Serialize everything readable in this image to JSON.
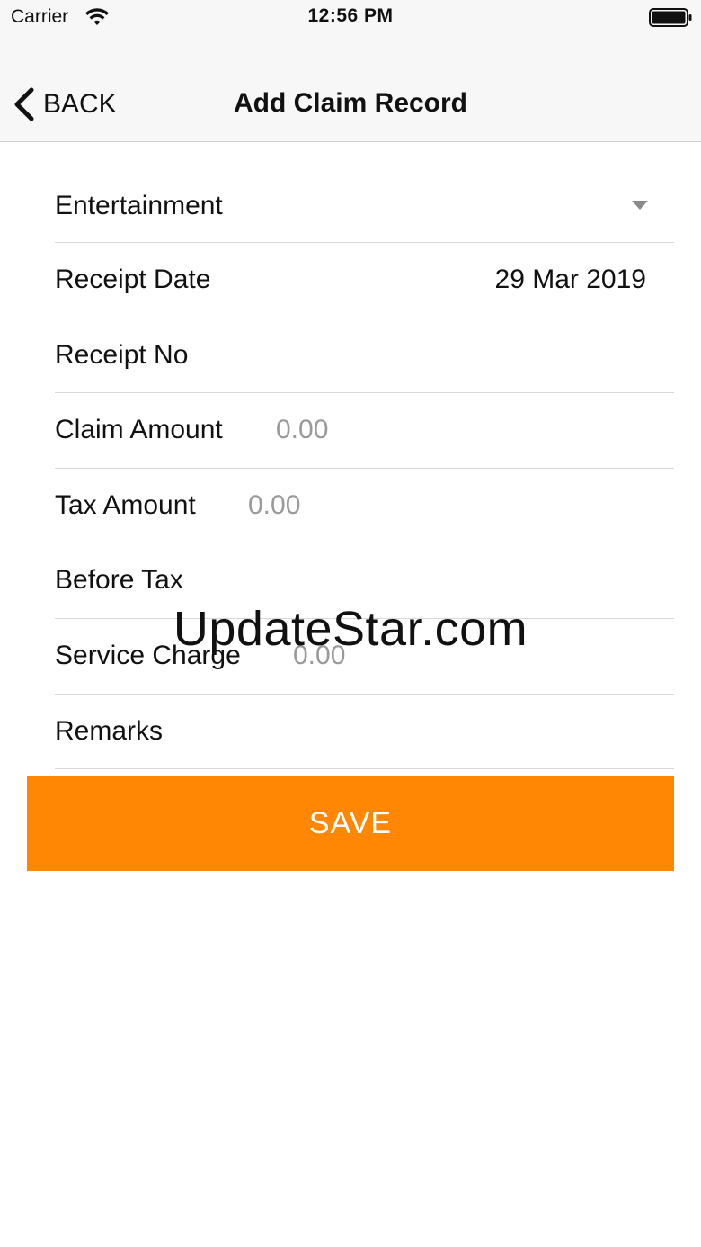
{
  "status_bar": {
    "carrier": "Carrier",
    "time": "12:56 PM",
    "wifi_icon": "wifi-icon",
    "battery_icon": "battery-icon"
  },
  "nav": {
    "back_label": "BACK",
    "back_icon": "chevron-left-icon",
    "title": "Add Claim Record"
  },
  "form": {
    "category": {
      "value": "Entertainment",
      "icon": "dropdown-arrow-icon"
    },
    "receipt_date": {
      "label": "Receipt Date",
      "value": "29 Mar 2019"
    },
    "receipt_no": {
      "label": "Receipt No"
    },
    "claim_amount": {
      "label": "Claim Amount",
      "placeholder": "0.00"
    },
    "tax_amount": {
      "label": "Tax Amount",
      "placeholder": "0.00"
    },
    "before_tax": {
      "label": "Before Tax"
    },
    "service_charge": {
      "label": "Service Charge",
      "placeholder": "0.00"
    },
    "remarks": {
      "label": "Remarks"
    }
  },
  "save_button": {
    "label": "SAVE",
    "color": "#ff8703"
  },
  "watermark": {
    "text": "UpdateStar.com"
  }
}
